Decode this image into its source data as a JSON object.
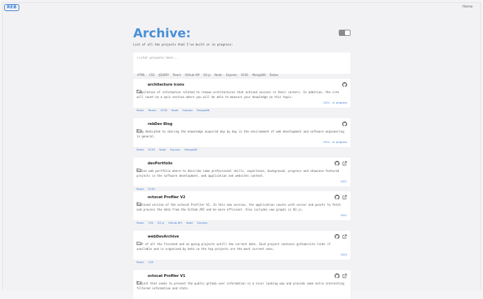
{
  "header": {
    "logo": "REB",
    "home_link": "Home"
  },
  "page": {
    "title": "Archive:",
    "subtitle": "List of all the projects that I've built or in progress:"
  },
  "filter": {
    "placeholder": "Filter projects here...",
    "tags": [
      "HTML",
      "CSS",
      "JQUERY",
      "React",
      "Github API",
      "D3.js",
      "Node",
      "Express",
      "SCSS",
      "MongoDB",
      "Redux"
    ]
  },
  "projects": [
    {
      "title": "architecture icons",
      "description": "Compilation of information related to renown architectures that achived success in their careers. In addition, the site will count on a quiz section where you will be able to measure your knowledge on this topic.",
      "techs": [
        "React",
        "Redux",
        "SCSS",
        "Node",
        "Express",
        "MongoDB"
      ],
      "status": "2021 - In progress",
      "icons": [
        "github-icon"
      ]
    },
    {
      "title": "rebDev Blog",
      "description": "Blog dedicated to sharing the knowledge acquired day by day in the environment of web development and software engineering in general.",
      "techs": [
        "React",
        "SCSS",
        "Node",
        "Express",
        "MongoDB"
      ],
      "status": "2021 - In progress",
      "icons": [
        "github-icon"
      ]
    },
    {
      "title": "devPortfolio",
      "description": "Online web portfolio where to describe some professional skills, experience, background, progress and showcase featured projects in the software development, web application and websites context.",
      "techs": [
        "React",
        "SCSS"
      ],
      "status": "2021",
      "icons": [
        "github-icon",
        "external-link-icon"
      ]
    },
    {
      "title": "octocat Profiler V2",
      "description": "Improved version of the octocat Profiler V1. In this new version, the application counts with server and points to fetch and process the data from the Github API and be more efficient. Also includes new graphs in D3.js.",
      "techs": [
        "React",
        "CSS",
        "D3.js",
        "Github API",
        "Node",
        "Express"
      ],
      "status": "2021",
      "icons": [
        "github-icon",
        "external-link-icon"
      ]
    },
    {
      "title": "webDevArchive",
      "description": "List of all the finished and on going projects untill the current date. Each project contains github/site links if available and is organised by date so the top projects are the most current ones.",
      "techs": [
        "React",
        "CSS"
      ],
      "status": "2020",
      "icons": [
        "github-icon",
        "external-link-icon"
      ]
    },
    {
      "title": "octocat Profiler V1",
      "description": "Project that seeks to present the public github user information in a nicer looking way and provide some extra interesting filtered information and stats.",
      "techs": [],
      "status": "",
      "icons": [
        "github-icon",
        "external-link-icon"
      ]
    }
  ],
  "colors": {
    "accent": "#3a7bd5",
    "title": "#4a90d9",
    "background": "#f2f2f4",
    "card": "#ffffff"
  }
}
